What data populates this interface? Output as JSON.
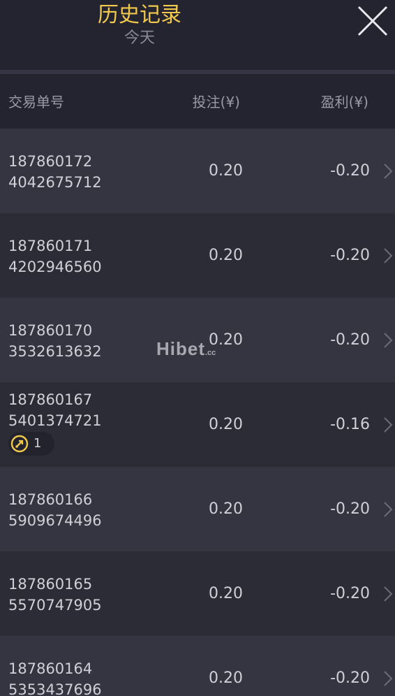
{
  "header": {
    "title": "历史记录",
    "subtitle": "今天",
    "close_icon": "close-icon"
  },
  "columns": {
    "order": "交易单号",
    "bet": "投注(¥)",
    "profit": "盈利(¥)"
  },
  "colors": {
    "title": "#f2c94c",
    "badge_icon": "#f2c94c"
  },
  "rows": [
    {
      "order_line1": "187860172",
      "order_line2": "4042675712",
      "bet": "0.20",
      "profit": "-0.20"
    },
    {
      "order_line1": "187860171",
      "order_line2": "4202946560",
      "bet": "0.20",
      "profit": "-0.20"
    },
    {
      "order_line1": "187860170",
      "order_line2": "3532613632",
      "bet": "0.20",
      "profit": "-0.20"
    },
    {
      "order_line1": "187860167",
      "order_line2": "5401374721",
      "bet": "0.20",
      "profit": "-0.16",
      "badge": {
        "icon": "spin-icon",
        "count": "1"
      }
    },
    {
      "order_line1": "187860166",
      "order_line2": "5909674496",
      "bet": "0.20",
      "profit": "-0.20"
    },
    {
      "order_line1": "187860165",
      "order_line2": "5570747905",
      "bet": "0.20",
      "profit": "-0.20"
    },
    {
      "order_line1": "187860164",
      "order_line2": "5353437696",
      "bet": "0.20",
      "profit": "-0.20"
    }
  ],
  "watermark": {
    "text": "Hibet",
    "suffix": ".cc"
  }
}
